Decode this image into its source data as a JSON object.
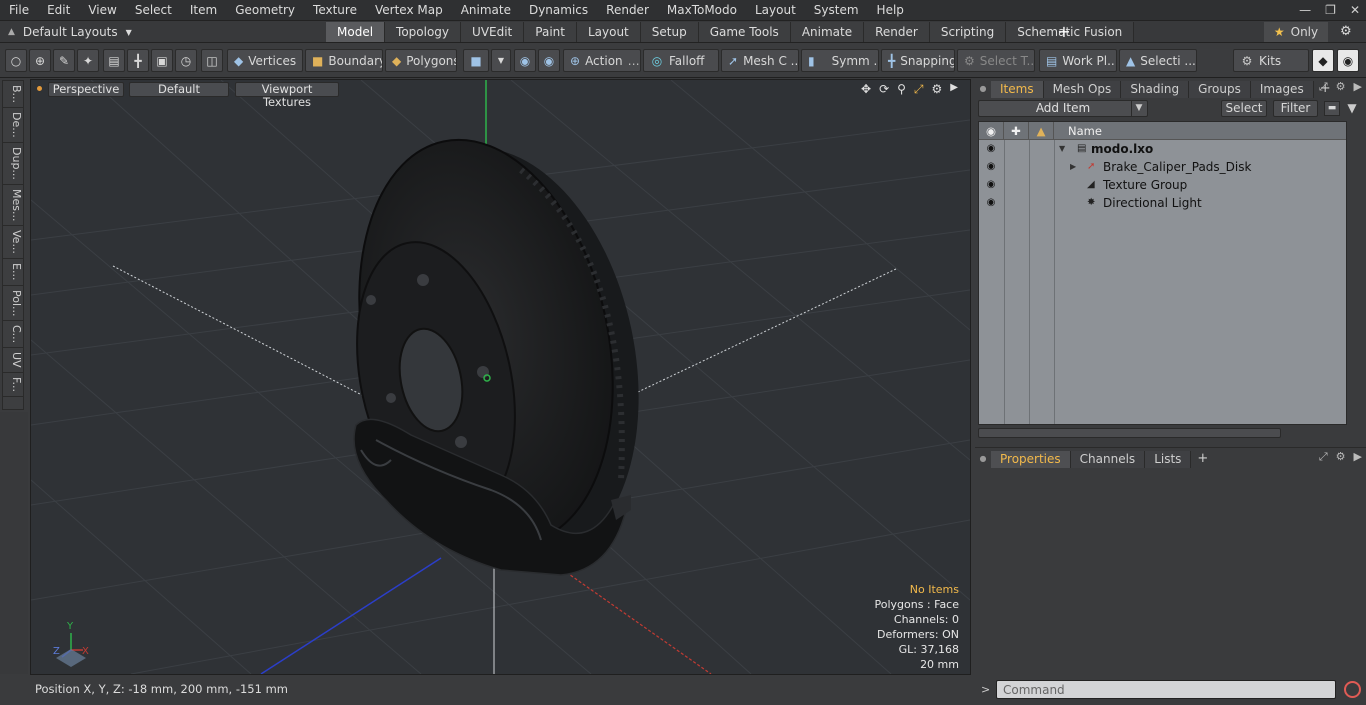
{
  "menu": {
    "items": [
      "File",
      "Edit",
      "View",
      "Select",
      "Item",
      "Geometry",
      "Texture",
      "Vertex Map",
      "Animate",
      "Dynamics",
      "Render",
      "MaxToModo",
      "Layout",
      "System",
      "Help"
    ]
  },
  "tabs_row": {
    "layout_label": "Default Layouts",
    "mode_tabs": [
      "Model",
      "Topology",
      "UVEdit",
      "Paint",
      "Layout",
      "Setup",
      "Game Tools",
      "Animate",
      "Render",
      "Scripting",
      "Schematic Fusion"
    ],
    "active_tab": "Model",
    "only_label": "Only"
  },
  "toolbar": {
    "vertices": "Vertices",
    "boundary": "Boundary",
    "polygons": "Polygons",
    "action": "Action",
    "falloff": "Falloff",
    "mesh": "Mesh C ...",
    "symm": "Symm ...",
    "snapping": "Snapping",
    "select_t": "Select T...",
    "work_pl": "Work Pl...",
    "selecti": "Selecti ...",
    "kits": "Kits"
  },
  "left_tabs": [
    "B...",
    "De...",
    "Dup...",
    "Mes...",
    "Ve...",
    "E...",
    "Pol...",
    "C...",
    "UV",
    "F..."
  ],
  "viewport": {
    "view_mode": "Perspective",
    "shading": "Default",
    "textures": "Viewport Textures",
    "stats": {
      "selection": "No Items",
      "polygons": "Polygons : Face",
      "channels": "Channels: 0",
      "deformers": "Deformers: ON",
      "gl": "GL: 37,168",
      "scale": "20 mm"
    },
    "axis_y": "Y",
    "axis_x": "X",
    "axis_z": "Z"
  },
  "status": {
    "position": "Position X, Y, Z:   -18 mm, 200 mm, -151 mm"
  },
  "items_panel": {
    "tabs": [
      "Items",
      "Mesh Ops",
      "Shading",
      "Groups",
      "Images"
    ],
    "active_tab": "Items",
    "add_item": "Add Item",
    "select": "Select",
    "filter": "Filter",
    "name_header": "Name",
    "rows": [
      {
        "label": "modo.lxo"
      },
      {
        "label": "Brake_Caliper_Pads_Disk"
      },
      {
        "label": "Texture Group"
      },
      {
        "label": "Directional Light"
      }
    ]
  },
  "props_panel": {
    "tabs": [
      "Properties",
      "Channels",
      "Lists"
    ],
    "active_tab": "Properties"
  },
  "command": {
    "placeholder": "Command"
  },
  "colors": {
    "accent_orange": "#f2b94b",
    "axis_x": "#c23b33",
    "axis_y": "#2fb34a",
    "axis_z": "#2b3ec9",
    "record": "#e05b55"
  }
}
